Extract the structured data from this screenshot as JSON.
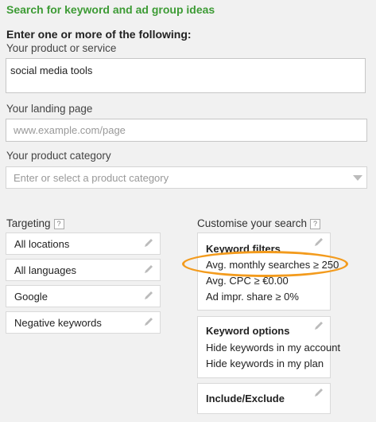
{
  "section_title": "Search for keyword and ad group ideas",
  "subheading": "Enter one or more of the following:",
  "product": {
    "label": "Your product or service",
    "value": "social media tools"
  },
  "landing_page": {
    "label": "Your landing page",
    "placeholder": "www.example.com/page"
  },
  "category": {
    "label": "Your product category",
    "placeholder": "Enter or select a product category"
  },
  "targeting": {
    "heading": "Targeting",
    "help": "?",
    "items": [
      {
        "label": "All locations"
      },
      {
        "label": "All languages"
      },
      {
        "label": "Google"
      },
      {
        "label": "Negative keywords"
      }
    ]
  },
  "customise": {
    "heading": "Customise your search",
    "help": "?",
    "keyword_filters": {
      "title": "Keyword filters",
      "lines": [
        "Avg. monthly searches ≥ 250",
        "Avg. CPC ≥ €0.00",
        "Ad impr. share ≥ 0%"
      ]
    },
    "keyword_options": {
      "title": "Keyword options",
      "lines": [
        "Hide keywords in my account",
        "Hide keywords in my plan"
      ]
    },
    "include_exclude": {
      "title": "Include/Exclude"
    }
  },
  "colors": {
    "title_green": "#3d9b35",
    "highlight_orange": "#f39b1d"
  },
  "icons": {
    "edit": "pencil-icon",
    "help": "help-icon",
    "dropdown": "caret-down-icon"
  }
}
